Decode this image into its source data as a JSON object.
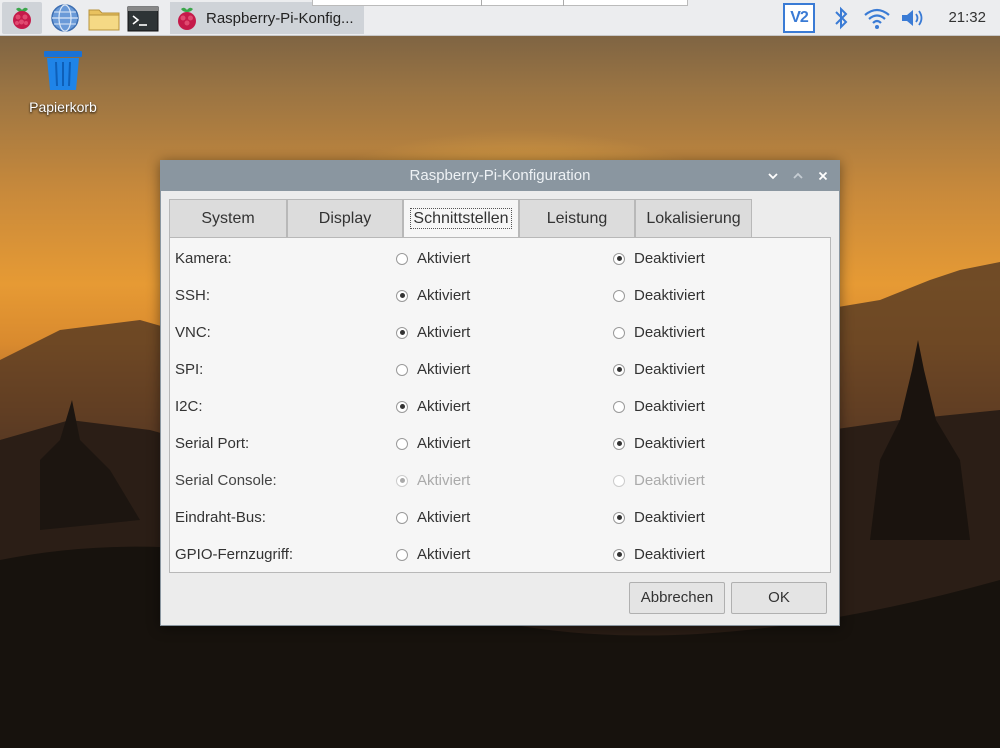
{
  "panel": {
    "active_task": "Raspberry-Pi-Konfig...",
    "clock": "21:32",
    "vnc_label": "V2"
  },
  "desktop": {
    "trash_label": "Papierkorb"
  },
  "dialog": {
    "title": "Raspberry-Pi-Konfiguration",
    "tabs": [
      {
        "label": "System"
      },
      {
        "label": "Display"
      },
      {
        "label": "Schnittstellen"
      },
      {
        "label": "Leistung"
      },
      {
        "label": "Lokalisierung"
      }
    ],
    "active_tab": "Schnittstellen",
    "on_label": "Aktiviert",
    "off_label": "Deaktiviert",
    "interfaces": [
      {
        "label": "Kamera:",
        "enabled": false,
        "disabled_control": false
      },
      {
        "label": "SSH:",
        "enabled": true,
        "disabled_control": false
      },
      {
        "label": "VNC:",
        "enabled": true,
        "disabled_control": false
      },
      {
        "label": "SPI:",
        "enabled": false,
        "disabled_control": false
      },
      {
        "label": "I2C:",
        "enabled": true,
        "disabled_control": false
      },
      {
        "label": "Serial Port:",
        "enabled": false,
        "disabled_control": false
      },
      {
        "label": "Serial Console:",
        "enabled": true,
        "disabled_control": true
      },
      {
        "label": "Eindraht-Bus:",
        "enabled": false,
        "disabled_control": false
      },
      {
        "label": "GPIO-Fernzugriff:",
        "enabled": false,
        "disabled_control": false
      }
    ],
    "cancel_label": "Abbrechen",
    "ok_label": "OK"
  },
  "colors": {
    "titlebar": "#8a96a0",
    "accent_blue": "#3a7bd5",
    "raspberry_red": "#c51a4a"
  },
  "icons": {
    "menu": "raspberry-icon",
    "browser": "globe-icon",
    "files": "folder-icon",
    "terminal": "terminal-icon",
    "bluetooth": "bluetooth-icon",
    "wifi": "wifi-icon",
    "volume": "volume-icon",
    "trash": "trash-icon"
  }
}
